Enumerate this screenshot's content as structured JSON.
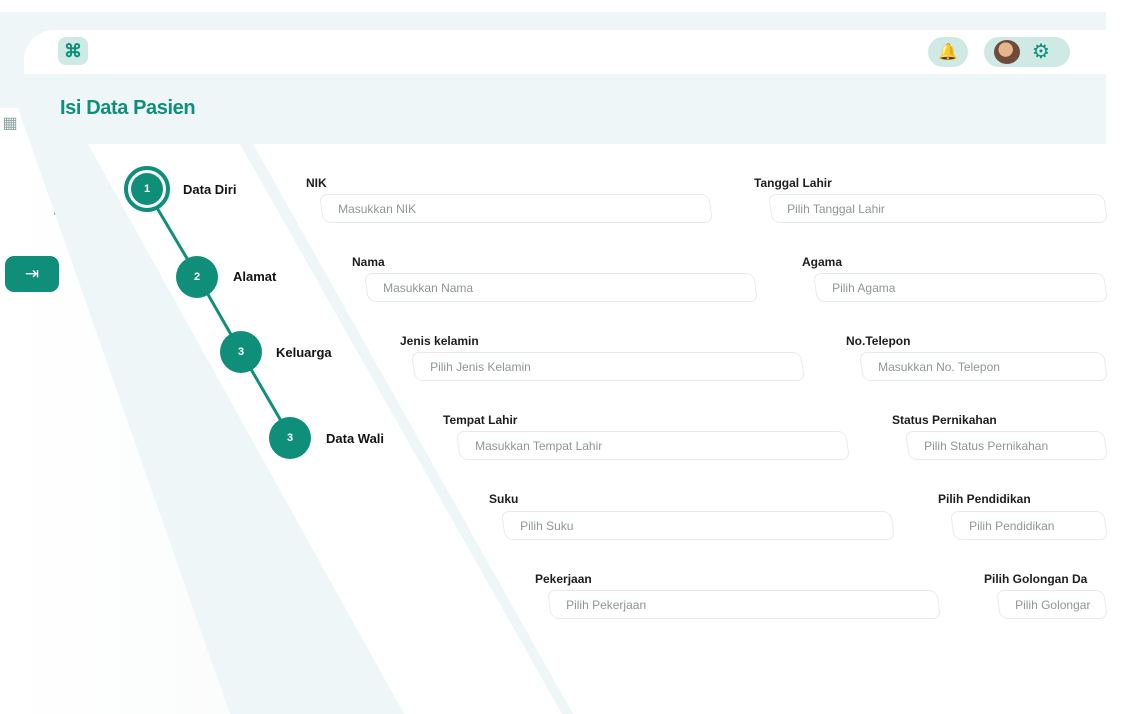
{
  "header": {
    "title": "Isi Data Pasien",
    "app_icon": "command-icon",
    "notification_icon": "bell-icon",
    "settings_icon": "gear-icon"
  },
  "sidebar": {
    "items": [
      {
        "icon": "grid-icon"
      },
      {
        "icon": "login-icon",
        "active": true
      },
      {
        "icon": "calendar-icon"
      },
      {
        "icon": "report-icon"
      },
      {
        "icon": "patient-card-icon"
      },
      {
        "icon": "add-document-icon"
      }
    ]
  },
  "steps": [
    {
      "number": "1",
      "label": "Data Diri",
      "active": true
    },
    {
      "number": "2",
      "label": "Alamat",
      "active": false
    },
    {
      "number": "3",
      "label": "Keluarga",
      "active": false
    },
    {
      "number": "3",
      "label": "Data Wali",
      "active": false
    }
  ],
  "form": {
    "left": [
      {
        "label": "NIK",
        "placeholder": "Masukkan NIK"
      },
      {
        "label": "Nama",
        "placeholder": "Masukkan Nama"
      },
      {
        "label": "Jenis kelamin",
        "placeholder": "Pilih Jenis Kelamin"
      },
      {
        "label": "Tempat Lahir",
        "placeholder": "Masukkan Tempat Lahir"
      },
      {
        "label": "Suku",
        "placeholder": "Pilih Suku"
      },
      {
        "label": "Pekerjaan",
        "placeholder": "Pilih Pekerjaan"
      }
    ],
    "right": [
      {
        "label": "Tanggal Lahir",
        "placeholder": "Pilih Tanggal Lahir"
      },
      {
        "label": "Agama",
        "placeholder": "Pilih Agama"
      },
      {
        "label": "No.Telepon",
        "placeholder": "Masukkan No. Telepon"
      },
      {
        "label": "Status Pernikahan",
        "placeholder": "Pilih Status Pernikahan"
      },
      {
        "label": "Pilih Pendidikan",
        "placeholder": "Pilih Pendidikan"
      },
      {
        "label": "Pilih Golongan Da",
        "placeholder": "Pilih Golongar"
      }
    ]
  },
  "colors": {
    "accent": "#0f8f7a",
    "accent_soft": "#cfe9e4",
    "background": "#eef6f7"
  }
}
